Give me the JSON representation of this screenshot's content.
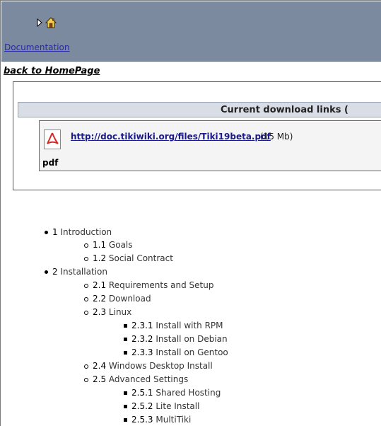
{
  "header": {
    "breadcrumb_link": "Documentation"
  },
  "nav": {
    "back_link": "back to HomePage"
  },
  "downloads": {
    "title": "Current download links (",
    "file_type_label": "pdf",
    "file_link": "http://doc.tikiwiki.org/files/Tiki19beta.pdf",
    "file_size": "(15 Mb)"
  },
  "toc": [
    {
      "level": 1,
      "num": "1",
      "label": "Introduction"
    },
    {
      "level": 2,
      "num": "1.1",
      "label": "Goals"
    },
    {
      "level": 2,
      "num": "1.2",
      "label": "Social Contract"
    },
    {
      "level": 1,
      "num": "2",
      "label": "Installation"
    },
    {
      "level": 2,
      "num": "2.1",
      "label": "Requirements and Setup"
    },
    {
      "level": 2,
      "num": "2.2",
      "label": "Download"
    },
    {
      "level": 2,
      "num": "2.3",
      "label": "Linux"
    },
    {
      "level": 3,
      "num": "2.3.1",
      "label": "Install with RPM"
    },
    {
      "level": 3,
      "num": "2.3.2",
      "label": "Install on Debian"
    },
    {
      "level": 3,
      "num": "2.3.3",
      "label": "Install on Gentoo"
    },
    {
      "level": 2,
      "num": "2.4",
      "label": "Windows Desktop Install"
    },
    {
      "level": 2,
      "num": "2.5",
      "label": "Advanced Settings"
    },
    {
      "level": 3,
      "num": "2.5.1",
      "label": "Shared Hosting"
    },
    {
      "level": 3,
      "num": "2.5.2",
      "label": "Lite Install"
    },
    {
      "level": 3,
      "num": "2.5.3",
      "label": "MultiTiki"
    }
  ],
  "icons": {
    "breadcrumb_arrow": "triangle-right-icon",
    "home": "home-icon",
    "pdf": "pdf-icon"
  },
  "colors": {
    "header_bg": "#7c8aa0",
    "link": "#2a2aa0",
    "download_header_bg": "#d9dde6",
    "pdf_red": "#d22b2b"
  }
}
